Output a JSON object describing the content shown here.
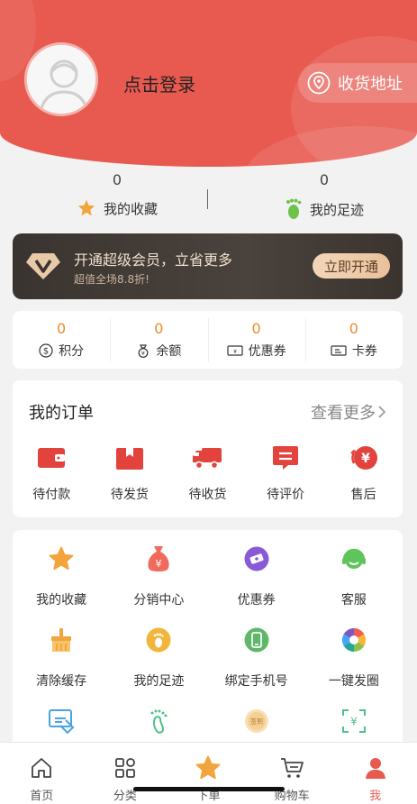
{
  "header": {
    "login_text": "点击登录",
    "address_label": "收货地址",
    "bg_color": "#e85a50"
  },
  "stats": {
    "favorites": {
      "count": "0",
      "label": "我的收藏"
    },
    "footprints": {
      "count": "0",
      "label": "我的足迹"
    }
  },
  "vip": {
    "title": "开通超级会员，立省更多",
    "subtitle": "超值全场8.8折!",
    "button": "立即开通"
  },
  "assets": [
    {
      "value": "0",
      "label": "积分",
      "icon": "points-icon"
    },
    {
      "value": "0",
      "label": "余额",
      "icon": "balance-icon"
    },
    {
      "value": "0",
      "label": "优惠券",
      "icon": "coupon-icon"
    },
    {
      "value": "0",
      "label": "卡券",
      "icon": "card-icon"
    }
  ],
  "orders": {
    "title": "我的订单",
    "more": "查看更多",
    "items": [
      {
        "label": "待付款",
        "icon": "wallet-icon"
      },
      {
        "label": "待发货",
        "icon": "package-icon"
      },
      {
        "label": "待收货",
        "icon": "truck-icon"
      },
      {
        "label": "待评价",
        "icon": "comment-icon"
      },
      {
        "label": "售后",
        "icon": "refund-icon"
      }
    ]
  },
  "services": [
    {
      "label": "我的收藏",
      "icon": "star-icon"
    },
    {
      "label": "分销中心",
      "icon": "money-bag-icon"
    },
    {
      "label": "优惠券",
      "icon": "ticket-icon"
    },
    {
      "label": "客服",
      "icon": "headset-icon"
    },
    {
      "label": "清除缓存",
      "icon": "broom-icon"
    },
    {
      "label": "我的足迹",
      "icon": "footprint-icon"
    },
    {
      "label": "绑定手机号",
      "icon": "phone-icon"
    },
    {
      "label": "一键发圈",
      "icon": "aperture-icon"
    },
    {
      "label": "",
      "icon": "invoice-icon"
    },
    {
      "label": "",
      "icon": "footprint-outline-icon"
    },
    {
      "label": "",
      "icon": "sign-in-icon",
      "badge": "签到"
    },
    {
      "label": "",
      "icon": "scan-icon"
    }
  ],
  "tabbar": [
    {
      "label": "首页",
      "icon": "home-icon"
    },
    {
      "label": "分类",
      "icon": "category-icon"
    },
    {
      "label": "下单",
      "icon": "star-order-icon"
    },
    {
      "label": "购物车",
      "icon": "cart-icon"
    },
    {
      "label": "我",
      "icon": "user-icon",
      "active": true
    }
  ]
}
